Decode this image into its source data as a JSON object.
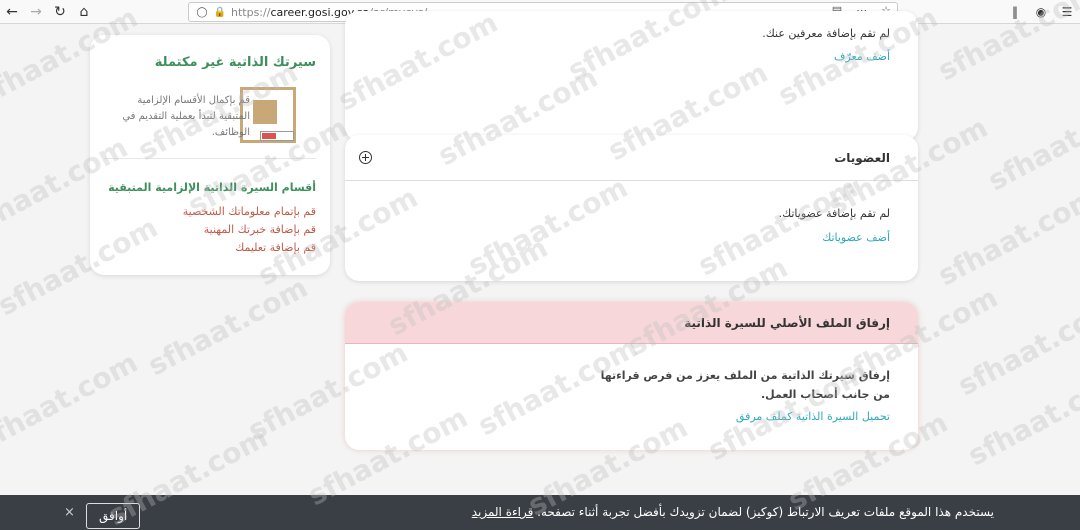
{
  "browser": {
    "back_icon": "back-arrow-icon",
    "forward_icon": "forward-arrow-icon",
    "reload_icon": "reload-icon",
    "home_icon": "home-icon",
    "url_prefix": "https://",
    "url_host": "career.gosi.gov.sa",
    "url_path": "/ar/mycvs/"
  },
  "references_card": {
    "empty_text": "لم تقم بإضافة معرفين عنك.",
    "add_link": "أضف معرّف"
  },
  "memberships_card": {
    "title": "العضويات",
    "empty_text": "لم تقم بإضافة عضوياتك.",
    "add_link": "أضف عضوياتك"
  },
  "attachment_card": {
    "title": "إرفاق الملف الأصلي للسيرة الذاتية",
    "description": "إرفاق سيرتك الذاتية من الملف يعزز من فرص قراءتها من جانب أصحاب العمل.",
    "upload_link": "تحميل السيرة الذاتية كملف مرفق"
  },
  "sidebar": {
    "title": "سيرتك الذاتية غير مكتملة",
    "description": "قم بإكمال الأقسام الإلزامية المتبقية لتبدأ بعملية التقديم في الوظائف.",
    "progress": 0.45,
    "progress_color": "#d9534f",
    "subtitle": "أقسام السيرة الذاتية الإلزامية المتبقية",
    "items": [
      "قم بإتمام معلوماتك الشخصية",
      "قم بإضافة خبرتك المهنية",
      "قم بإضافة تعليمك"
    ]
  },
  "cookie_bar": {
    "message": "يستخدم هذا الموقع ملفات تعريف الارتباط (كوكيز) لضمان تزويدك بأفضل تجربة أثناء تصفحه.",
    "more_link": "قراءة المزيد",
    "accept_button": "أوافق",
    "close": "×"
  },
  "watermark": "sfhaat.com",
  "colors": {
    "link": "#2fa8bd",
    "green": "#3d8f5c",
    "danger_header": "#f8d7da",
    "cookie_bg": "#3a3f45"
  }
}
